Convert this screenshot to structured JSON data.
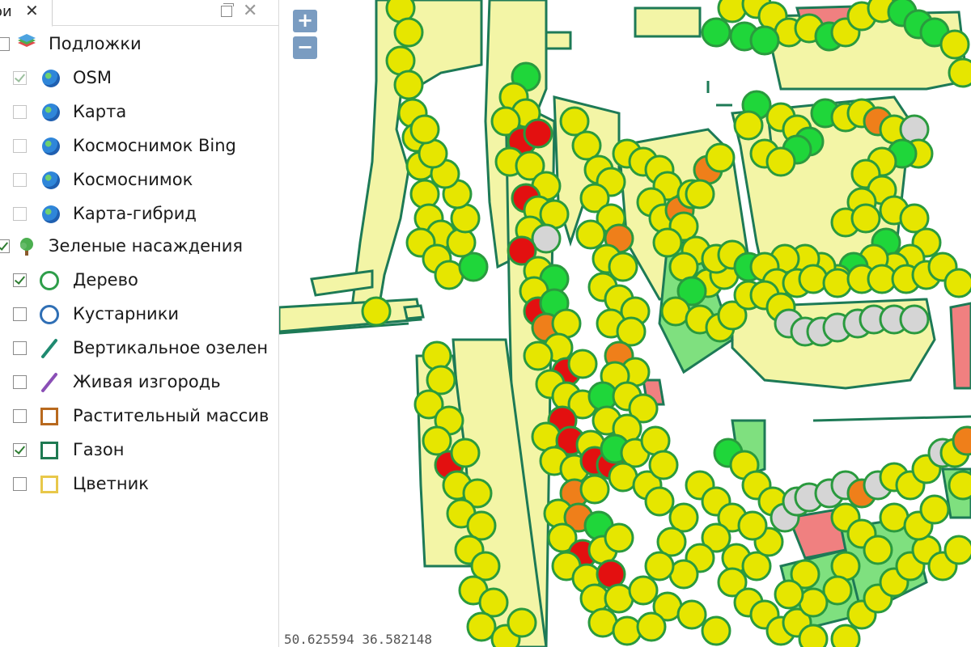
{
  "panel": {
    "tab_label": "ои",
    "close_glyph": "✕",
    "window_close_glyph": "✕",
    "groups": [
      {
        "label": "Подложки",
        "icon": "layers-stack-icon",
        "checked": false,
        "items": [
          {
            "label": "OSM",
            "icon": "globe-icon",
            "checked": true,
            "disabled": true
          },
          {
            "label": "Карта",
            "icon": "globe-icon",
            "checked": false,
            "disabled": true
          },
          {
            "label": "Космоснимок Bing",
            "icon": "globe-icon",
            "checked": false,
            "disabled": true
          },
          {
            "label": "Космоснимок",
            "icon": "globe-icon",
            "checked": false,
            "disabled": true
          },
          {
            "label": "Карта-гибрид",
            "icon": "globe-icon",
            "checked": false,
            "disabled": true
          }
        ]
      },
      {
        "label": "Зеленые насаждения",
        "icon": "tree-icon",
        "checked": true,
        "items": [
          {
            "label": "Дерево",
            "icon": "tree-circle-symbol-icon",
            "checked": true,
            "color": "#2e9e4a"
          },
          {
            "label": "Кустарники",
            "icon": "shrub-circle-symbol-icon",
            "checked": false,
            "color": "#2f6fb5"
          },
          {
            "label": "Вертикальное озелен",
            "icon": "vertical-greening-line-icon",
            "checked": false,
            "color": "#1f8a70"
          },
          {
            "label": "Живая изгородь",
            "icon": "hedge-line-icon",
            "checked": false,
            "color": "#8a4fb6"
          },
          {
            "label": "Растительный массив",
            "icon": "vegetation-area-icon",
            "checked": false,
            "color": "#b8691e"
          },
          {
            "label": "Газон",
            "icon": "lawn-area-icon",
            "checked": true,
            "color": "#1f7a52"
          },
          {
            "label": "Цветник",
            "icon": "flowerbed-area-icon",
            "checked": false,
            "color": "#e8c84a"
          }
        ]
      }
    ]
  },
  "map": {
    "zoom_in_label": "+",
    "zoom_out_label": "−",
    "coordinates": "50.625594 36.582148",
    "colors": {
      "tree_good": "#e6e600",
      "tree_healthy": "#1fd63a",
      "tree_fair": "#ef7f1a",
      "tree_bad": "#e31010",
      "tree_unknown": "#d5d5d5",
      "tree_outline": "#2a9a3e",
      "lawn_fill": "#f3f5a6",
      "lawn_fill_green": "#7fe07f",
      "building_fill": "#f08080",
      "line": "#1d7a56"
    }
  }
}
